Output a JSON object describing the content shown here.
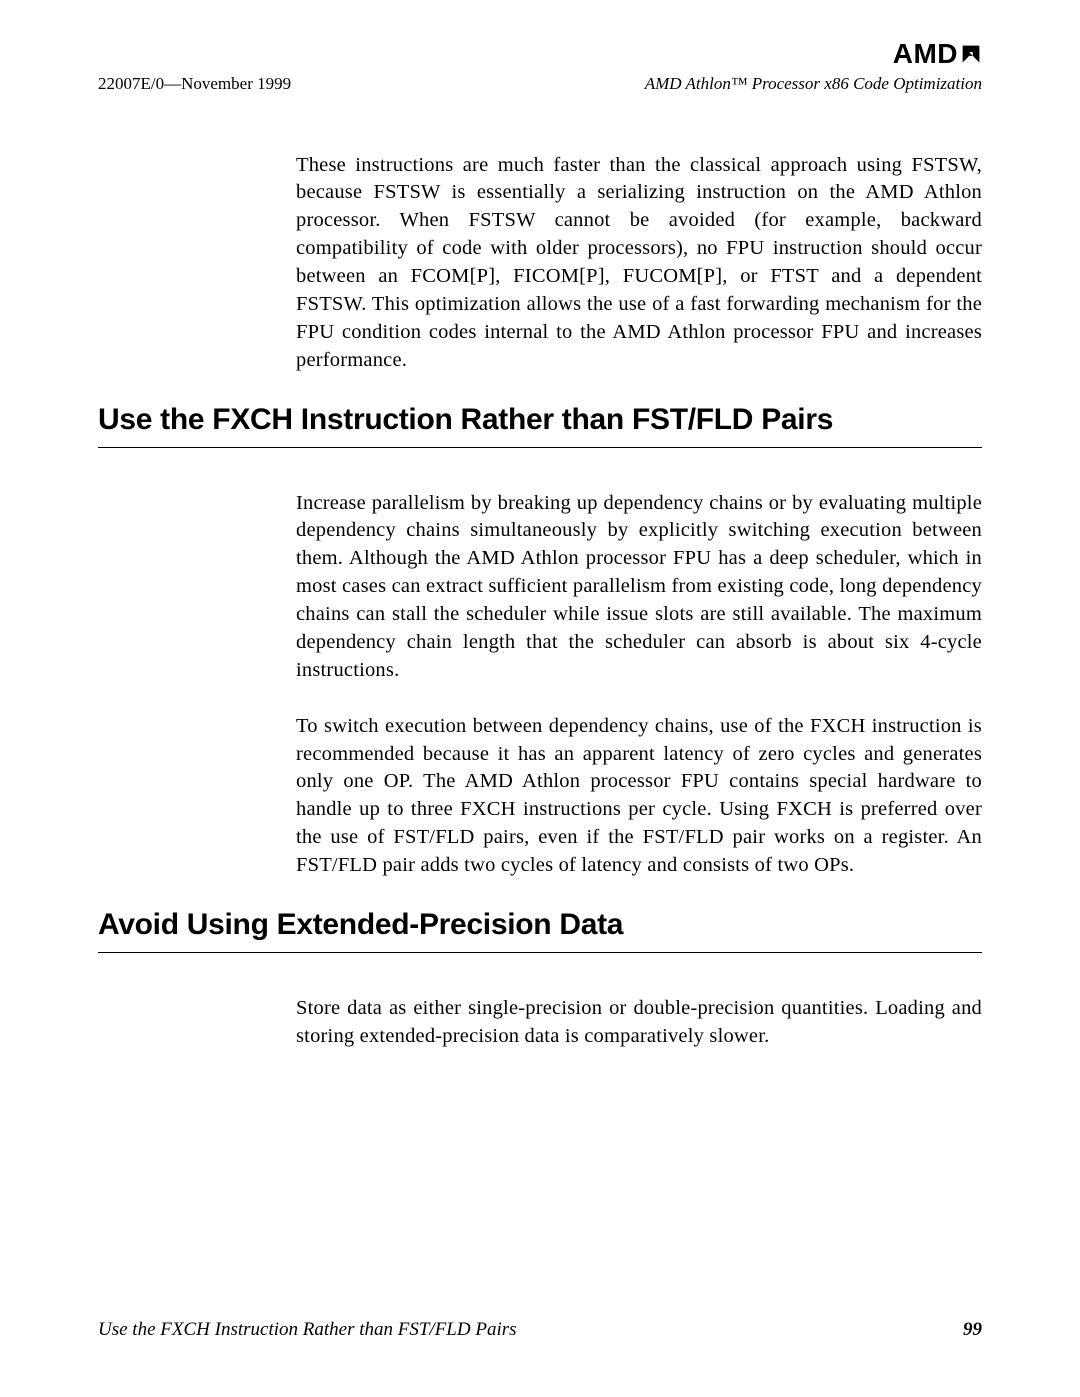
{
  "header": {
    "logo": "AMD",
    "doc_id": "22007E/0—November 1999",
    "doc_title": "AMD Athlon™ Processor x86 Code Optimization"
  },
  "body": {
    "intro_para": "These instructions are much faster than the classical approach using FSTSW, because FSTSW is essentially a serializing instruction on the AMD Athlon processor. When FSTSW cannot be avoided (for example, backward compatibility of code with older processors), no FPU instruction should occur between an FCOM[P], FICOM[P], FUCOM[P], or FTST and a dependent FSTSW. This optimization allows the use of a fast forwarding mechanism for the FPU condition codes internal to the AMD Athlon processor FPU and increases performance.",
    "section1": {
      "heading": "Use the FXCH Instruction Rather than FST/FLD Pairs",
      "para1": "Increase parallelism by breaking up dependency chains or by evaluating multiple dependency chains simultaneously by explicitly switching execution between them. Although the AMD Athlon processor FPU has a deep scheduler, which in most cases can extract sufficient parallelism from existing code, long dependency chains can stall the scheduler while issue slots are still available. The maximum dependency chain length that the scheduler can absorb is about six 4-cycle instructions.",
      "para2": "To switch execution between dependency chains, use of the FXCH instruction is recommended because it has an apparent latency of zero cycles and generates only one OP. The AMD Athlon processor FPU contains special hardware to handle up to three FXCH instructions per cycle. Using FXCH is preferred over the use of FST/FLD pairs, even if the FST/FLD pair works on a register. An FST/FLD pair adds two cycles of latency and consists of two OPs."
    },
    "section2": {
      "heading": "Avoid Using Extended-Precision Data",
      "para1": "Store data as either single-precision or double-precision quantities. Loading and storing extended-precision data is comparatively slower."
    }
  },
  "footer": {
    "section_title": "Use the FXCH Instruction Rather than FST/FLD Pairs",
    "page_number": "99"
  }
}
